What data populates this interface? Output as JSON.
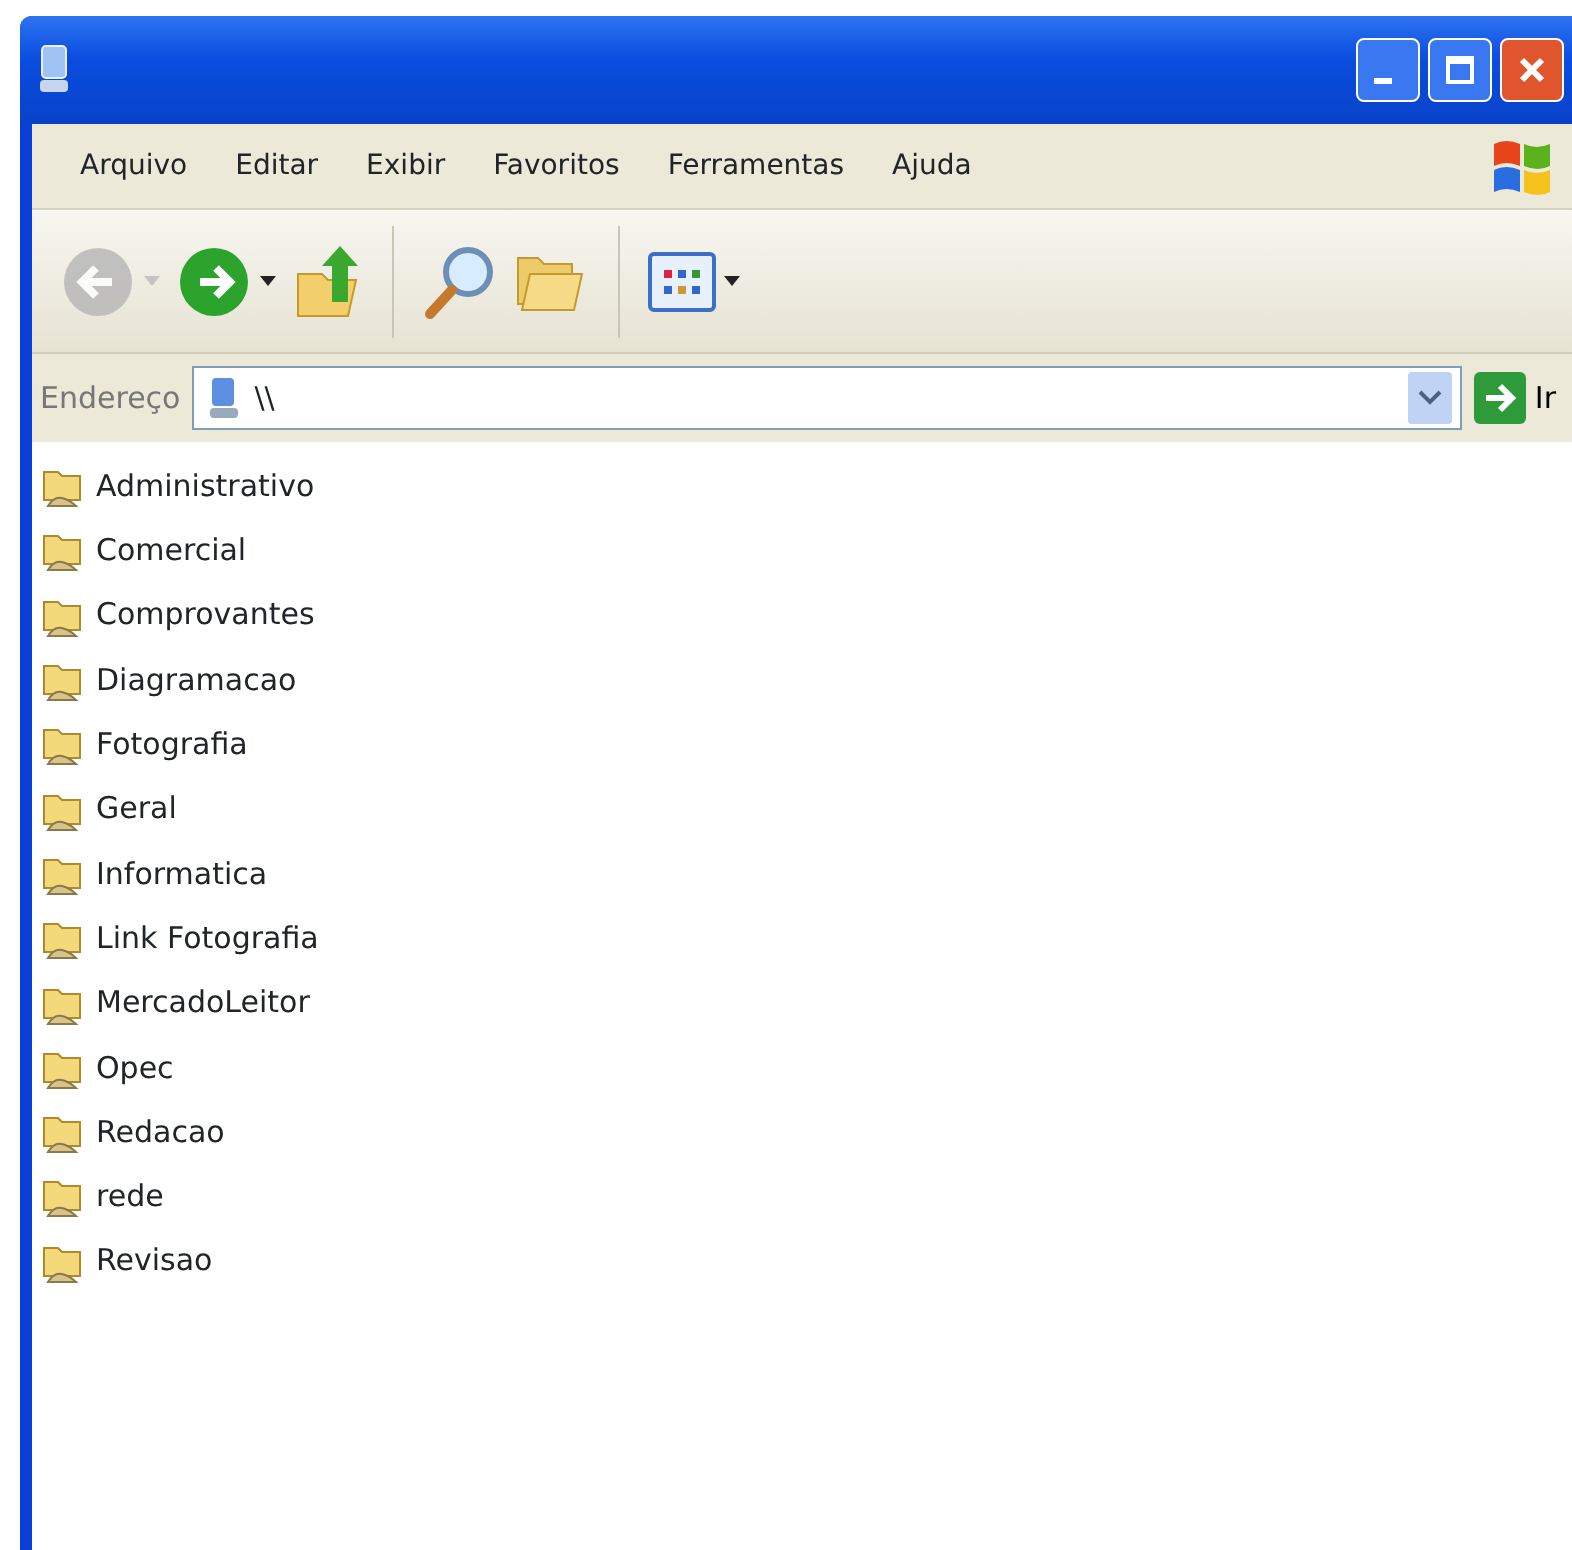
{
  "menu": [
    "Arquivo",
    "Editar",
    "Exibir",
    "Favoritos",
    "Ferramentas",
    "Ajuda"
  ],
  "toolbar": [
    {
      "kind": "back",
      "disabled": true
    },
    {
      "kind": "forward",
      "disabled": false
    },
    {
      "kind": "up",
      "disabled": false
    },
    {
      "kind": "search",
      "disabled": false
    },
    {
      "kind": "folders",
      "disabled": false
    },
    {
      "kind": "views",
      "disabled": false
    }
  ],
  "address": {
    "label": "Endereço",
    "value": "\\\\",
    "go": "Ir"
  },
  "items": [
    "Administrativo",
    "Comercial",
    "Comprovantes",
    "Diagramacao",
    "Fotografia",
    "Geral",
    "Informatica",
    "Link Fotografia",
    "MercadoLeitor",
    "Opec",
    "Redacao",
    "rede",
    "Revisao"
  ]
}
